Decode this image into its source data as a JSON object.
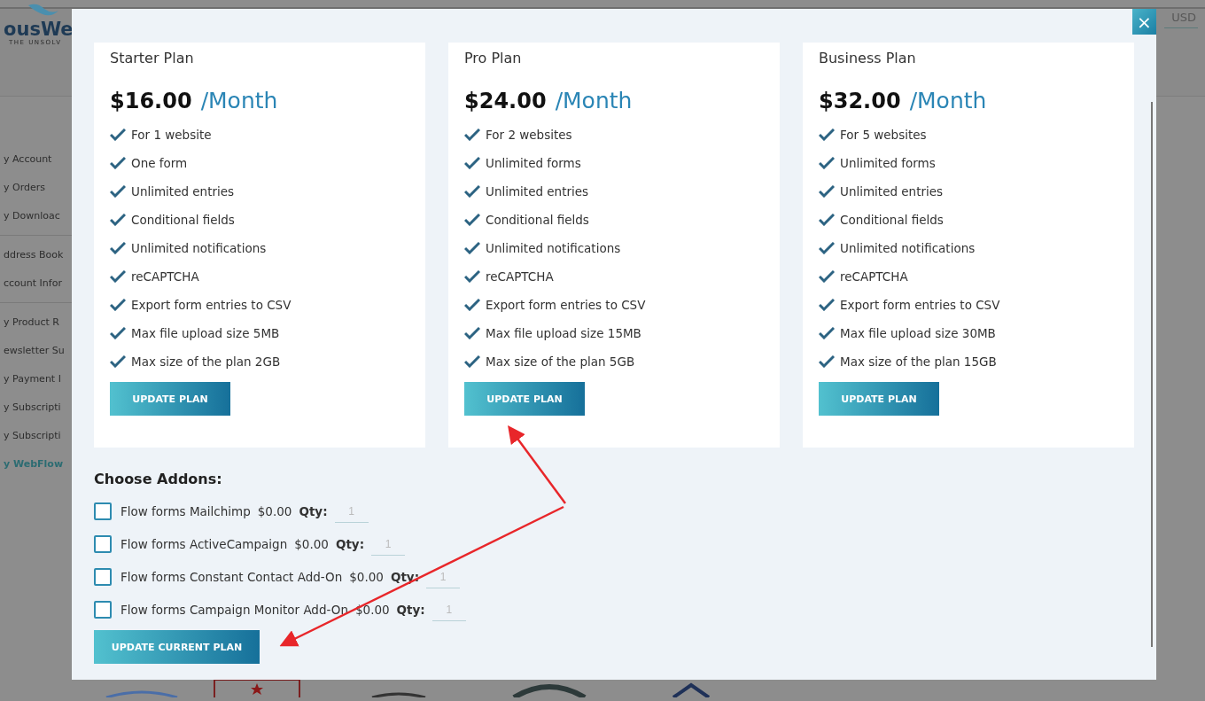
{
  "page": {
    "logo_text": "ousWe",
    "logo_tagline": "THE UNSOLV",
    "currency": "USD",
    "sidebar": [
      {
        "label": "y Account",
        "active": false
      },
      {
        "label": "y Orders",
        "active": false
      },
      {
        "label": "y Downloac",
        "active": false
      },
      {
        "label": "ddress Book",
        "active": false
      },
      {
        "label": "ccount Infor",
        "active": false
      },
      {
        "label": "y Product R",
        "active": false
      },
      {
        "label": "ewsletter Su",
        "active": false
      },
      {
        "label": "y Payment I",
        "active": false
      },
      {
        "label": "y Subscripti",
        "active": false
      },
      {
        "label": "y Subscripti",
        "active": false
      },
      {
        "label": "y WebFlow",
        "active": true
      }
    ]
  },
  "modal": {
    "close": "×",
    "plans": [
      {
        "name": "Starter Plan",
        "price": "$16.00",
        "period": "/Month",
        "features": [
          "For 1 website",
          "One form",
          "Unlimited entries",
          "Conditional fields",
          "Unlimited notifications",
          "reCAPTCHA",
          "Export form entries to CSV",
          "Max file upload size 5MB",
          "Max size of the plan 2GB"
        ],
        "button": "UPDATE PLAN"
      },
      {
        "name": "Pro Plan",
        "price": "$24.00",
        "period": "/Month",
        "features": [
          "For 2 websites",
          "Unlimited forms",
          "Unlimited entries",
          "Conditional fields",
          "Unlimited notifications",
          "reCAPTCHA",
          "Export form entries to CSV",
          "Max file upload size 15MB",
          "Max size of the plan 5GB"
        ],
        "button": "UPDATE PLAN"
      },
      {
        "name": "Business Plan",
        "price": "$32.00",
        "period": "/Month",
        "features": [
          "For 5 websites",
          "Unlimited forms",
          "Unlimited entries",
          "Conditional fields",
          "Unlimited notifications",
          "reCAPTCHA",
          "Export form entries to CSV",
          "Max file upload size 30MB",
          "Max size of the plan 15GB"
        ],
        "button": "UPDATE PLAN"
      }
    ],
    "addons_title": "Choose Addons:",
    "addons": [
      {
        "name": "Flow forms Mailchimp",
        "price": "$0.00",
        "qty_label": "Qty:",
        "qty": "1",
        "checked": false
      },
      {
        "name": "Flow forms ActiveCampaign",
        "price": "$0.00",
        "qty_label": "Qty:",
        "qty": "1",
        "checked": false
      },
      {
        "name": "Flow forms Constant Contact Add-On",
        "price": "$0.00",
        "qty_label": "Qty:",
        "qty": "1",
        "checked": false
      },
      {
        "name": "Flow forms Campaign Monitor Add-On",
        "price": "$0.00",
        "qty_label": "Qty:",
        "qty": "1",
        "checked": false
      }
    ],
    "submit": "UPDATE CURRENT PLAN"
  }
}
